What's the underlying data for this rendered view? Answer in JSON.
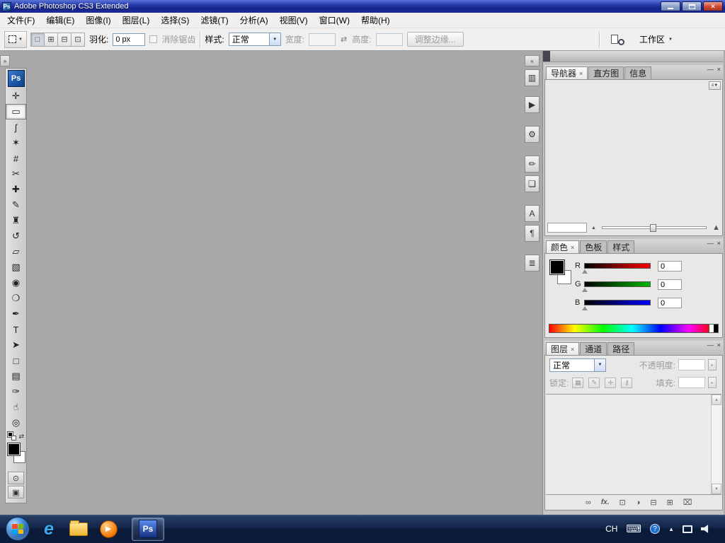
{
  "ui": {
    "caret": "▼",
    "arrow_right": "▸",
    "scroll_up": "▲",
    "scroll_down": "▼",
    "tab_close": "×",
    "panel_minimize": "—",
    "panel_close": "×",
    "panel_menu": "≡▼"
  },
  "titlebar": {
    "icon": "Ps",
    "title": "Adobe Photoshop CS3 Extended",
    "close_glyph": "✕"
  },
  "menubar": {
    "items": [
      "文件(F)",
      "编辑(E)",
      "图像(I)",
      "图层(L)",
      "选择(S)",
      "滤镜(T)",
      "分析(A)",
      "视图(V)",
      "窗口(W)",
      "帮助(H)"
    ]
  },
  "optionsbar": {
    "bool_new": "□",
    "bool_add": "⊞",
    "bool_subtract": "⊟",
    "bool_intersect": "⊡",
    "feather_label": "羽化:",
    "feather_value": "0 px",
    "antialias_label": "消除锯齿",
    "style_label": "样式:",
    "style_value": "正常",
    "width_label": "宽度:",
    "width_value": "",
    "swap_glyph": "⇄",
    "height_label": "高度:",
    "height_value": "",
    "refine_edge_label": "调整边缘...",
    "workspace_label": "工作区"
  },
  "workspace": {
    "left_handle": "»",
    "mid_handle": "«"
  },
  "toolbox": {
    "logo": "Ps",
    "tools": [
      {
        "name": "move",
        "glyph": "✛"
      },
      {
        "name": "rectangular-marquee",
        "glyph": "▭",
        "selected": true
      },
      {
        "name": "lasso",
        "glyph": "ʃ"
      },
      {
        "name": "magic-wand",
        "glyph": "✶"
      },
      {
        "name": "crop",
        "glyph": "#"
      },
      {
        "name": "slice",
        "glyph": "✂"
      },
      {
        "name": "healing-brush",
        "glyph": "✚"
      },
      {
        "name": "brush",
        "glyph": "✎"
      },
      {
        "name": "clone-stamp",
        "glyph": "♜"
      },
      {
        "name": "history-brush",
        "glyph": "↺"
      },
      {
        "name": "eraser",
        "glyph": "▱"
      },
      {
        "name": "gradient",
        "glyph": "▧"
      },
      {
        "name": "blur",
        "glyph": "◉"
      },
      {
        "name": "dodge",
        "glyph": "❍"
      },
      {
        "name": "pen",
        "glyph": "✒"
      },
      {
        "name": "type",
        "glyph": "T"
      },
      {
        "name": "path-selection",
        "glyph": "➤"
      },
      {
        "name": "rectangle-shape",
        "glyph": "□"
      },
      {
        "name": "notes",
        "glyph": "▤"
      },
      {
        "name": "eyedropper",
        "glyph": "✑"
      },
      {
        "name": "hand",
        "glyph": "☝"
      },
      {
        "name": "zoom",
        "glyph": "◎"
      }
    ],
    "swap_colors_glyph": "⇄",
    "foreground_color": "#000000",
    "background_color": "#ffffff",
    "quick_mask_glyph": "⊙",
    "screen_mode_glyph": "▣"
  },
  "mid_dock": {
    "icons": [
      {
        "name": "documents",
        "glyph": "▥"
      },
      {
        "name": "actions",
        "glyph": "▶"
      },
      {
        "name": "tool-presets",
        "glyph": "⚙"
      },
      {
        "name": "brushes",
        "glyph": "✏"
      },
      {
        "name": "clone-source",
        "glyph": "❏"
      },
      {
        "name": "character",
        "glyph": "A"
      },
      {
        "name": "paragraph",
        "glyph": "¶"
      },
      {
        "name": "layer-comps",
        "glyph": "≣"
      }
    ]
  },
  "panels": {
    "navigator": {
      "tabs": [
        "导航器",
        "直方图",
        "信息"
      ],
      "zoom_value": "",
      "zoom_out_glyph": "▲",
      "zoom_in_glyph": "▲"
    },
    "color": {
      "tabs": [
        "颜色",
        "色板",
        "样式"
      ],
      "foreground_color": "#000000",
      "background_color": "#ffffff",
      "sliders": [
        {
          "label": "R",
          "value": "0",
          "max_color": "#ff0000"
        },
        {
          "label": "G",
          "value": "0",
          "max_color": "#00b800"
        },
        {
          "label": "B",
          "value": "0",
          "max_color": "#0000ff"
        }
      ]
    },
    "layers": {
      "tabs": [
        "图层",
        "通道",
        "路径"
      ],
      "blend_mode": "正常",
      "opacity_label": "不透明度:",
      "opacity_value": "",
      "lock_label": "锁定:",
      "lock_icons": [
        "▦",
        "✎",
        "✛",
        "⚷"
      ],
      "fill_label": "填充:",
      "fill_value": "",
      "bottom_icons": [
        {
          "name": "link-layers",
          "glyph": "∞"
        },
        {
          "name": "layer-style",
          "glyph": "fx."
        },
        {
          "name": "layer-mask",
          "glyph": "⊡"
        },
        {
          "name": "adjustment-layer",
          "glyph": "◑"
        },
        {
          "name": "layer-group",
          "glyph": "⊟"
        },
        {
          "name": "new-layer",
          "glyph": "⊞"
        },
        {
          "name": "delete-layer",
          "glyph": "⌧"
        }
      ]
    }
  },
  "taskbar": {
    "ie_glyph": "e",
    "play_glyph": "▶",
    "ps_logo": "Ps",
    "tray_language": "CH",
    "keyboard_glyph": "⌨",
    "help_glyph": "?",
    "hidden_icons_glyph": "▲"
  }
}
